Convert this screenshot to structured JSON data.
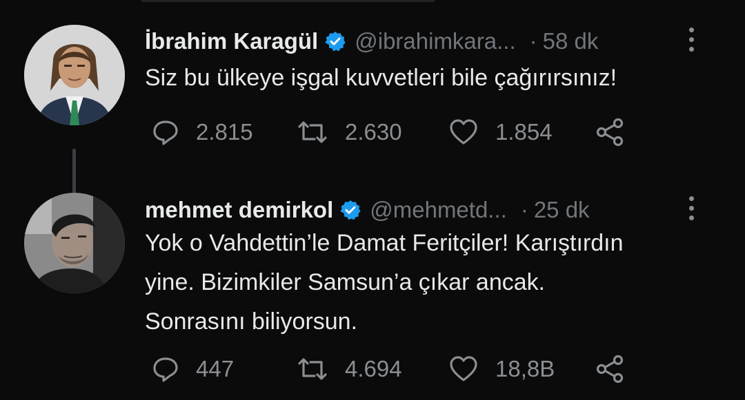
{
  "thread": [
    {
      "author": {
        "name": "İbrahim Karagül",
        "handle": "@ibrahimkara...",
        "verified": true
      },
      "time": "58 dk",
      "text_lines": [
        "Siz bu ülkeye işgal kuvvetleri bile çağırırsınız!"
      ],
      "stats": {
        "replies": "2.815",
        "retweets": "2.630",
        "likes": "1.854"
      }
    },
    {
      "author": {
        "name": "mehmet demirkol",
        "handle": "@mehmetd...",
        "verified": true
      },
      "time": "25 dk",
      "text_lines": [
        "Yok o Vahdettin’le Damat Feritçiler! Karıştırdın",
        "yine. Bizimkiler Samsun’a çıkar ancak.",
        "Sonrasını biliyorsun."
      ],
      "stats": {
        "replies": "447",
        "retweets": "4.694",
        "likes": "18,8B"
      }
    }
  ],
  "ui": {
    "separator": "·",
    "colors": {
      "background": "#0b0b0b",
      "text": "#e7e9ea",
      "muted": "#71767b",
      "verified": "#1d9bf0"
    },
    "icons": [
      "more-vertical-icon",
      "reply-icon",
      "retweet-icon",
      "like-icon",
      "share-icon",
      "verified-badge-icon"
    ]
  }
}
